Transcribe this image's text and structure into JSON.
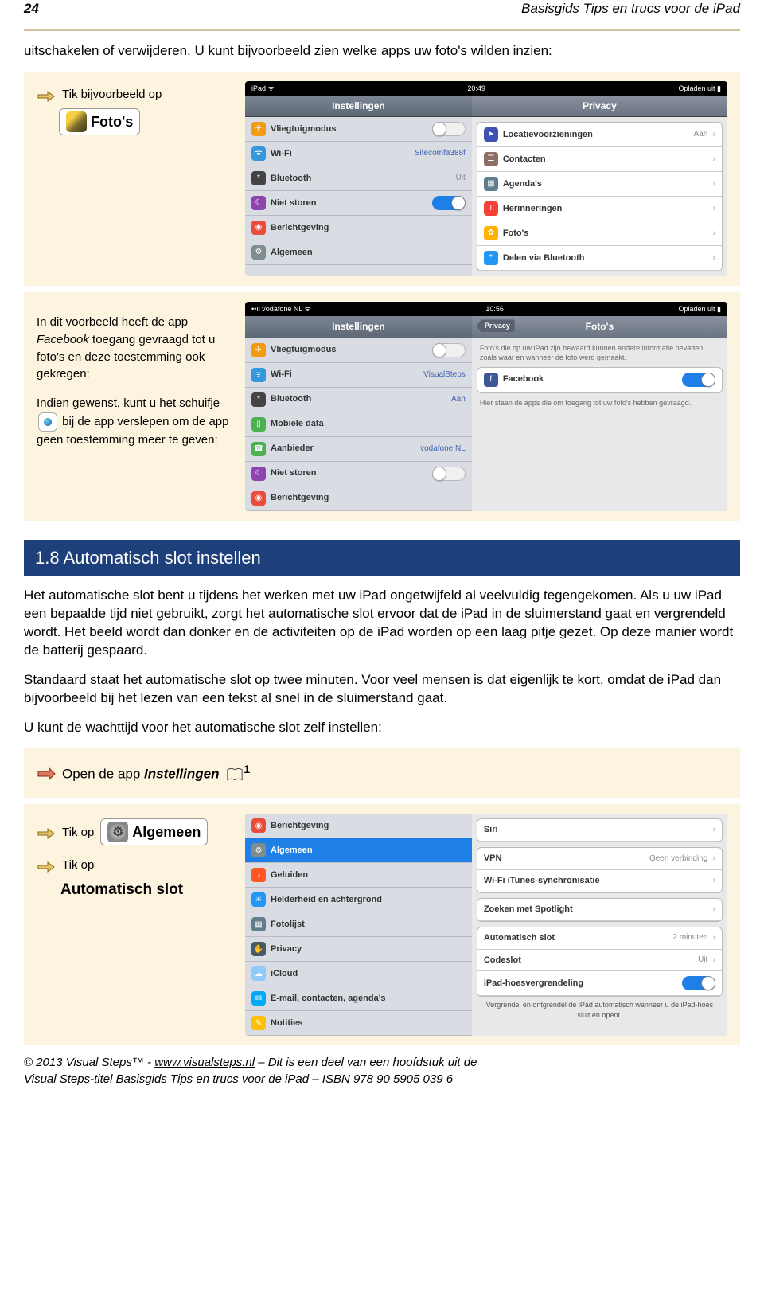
{
  "header": {
    "page": "24",
    "title": "Basisgids Tips en trucs voor de iPad"
  },
  "p1": "uitschakelen of verwijderen. U kunt bijvoorbeeld zien welke apps uw foto's wilden inzien:",
  "instr1": {
    "prefix": "Tik bijvoorbeeld op",
    "label": "Foto's"
  },
  "shot1": {
    "status": {
      "left": "iPad ᯤ",
      "mid": "20:49",
      "right": "Opladen uit ▮"
    },
    "leftTitle": "Instellingen",
    "rightTitle": "Privacy",
    "left": [
      {
        "icon": "#f39c12",
        "glyph": "✈",
        "lbl": "Vliegtuigmodus",
        "toggle": "off"
      },
      {
        "icon": "#3498db",
        "glyph": "ᯤ",
        "lbl": "Wi-Fi",
        "val": "Sitecomfa388f"
      },
      {
        "icon": "#444",
        "glyph": "*",
        "lbl": "Bluetooth",
        "valg": "Uit"
      },
      {
        "icon": "#8e44ad",
        "glyph": "☾",
        "lbl": "Niet storen",
        "toggle": "on"
      },
      {
        "icon": "#e74c3c",
        "glyph": "◉",
        "lbl": "Berichtgeving"
      },
      {
        "icon": "#7f8c8d",
        "glyph": "⚙",
        "lbl": "Algemeen"
      }
    ],
    "right": [
      {
        "icon": "#3f51b5",
        "glyph": "➤",
        "lbl": "Locatievoorzieningen",
        "valg": "Aan",
        "chev": true
      },
      {
        "icon": "#8d6e63",
        "glyph": "☰",
        "lbl": "Contacten",
        "chev": true
      },
      {
        "icon": "#607d8b",
        "glyph": "▦",
        "lbl": "Agenda's",
        "chev": true
      },
      {
        "icon": "#f44336",
        "glyph": "!",
        "lbl": "Herinneringen",
        "chev": true
      },
      {
        "icon": "#ffb300",
        "glyph": "✿",
        "lbl": "Foto's",
        "chev": true
      },
      {
        "icon": "#2196f3",
        "glyph": "*",
        "lbl": "Delen via Bluetooth",
        "chev": true
      }
    ]
  },
  "cream2": {
    "t1": "In dit voorbeeld heeft de app ",
    "t1b": "Facebook",
    "t1c": " toegang gevraagd tot u foto's en deze toestemming ook gekregen:",
    "t2a": "Indien gewenst, kunt u het schuifje ",
    "t2b": " bij de app verslepen om de app geen toestemming meer te geven:"
  },
  "shot2": {
    "status": {
      "left": "••ıl vodafone NL ᯤ",
      "mid": "10:56",
      "right": "Opladen uit ▮"
    },
    "leftTitle": "Instellingen",
    "rightTitle": "Foto's",
    "back": "Privacy",
    "note": "Foto's die op uw iPad zijn bewaard kunnen andere informatie bevatten, zoals waar en wanneer de foto werd gemaakt.",
    "fb": "Facebook",
    "note2": "Hier staan de apps die om toegang tot uw foto's hebben gevraagd.",
    "left": [
      {
        "icon": "#f39c12",
        "glyph": "✈",
        "lbl": "Vliegtuigmodus",
        "toggle": "off"
      },
      {
        "icon": "#3498db",
        "glyph": "ᯤ",
        "lbl": "Wi-Fi",
        "val": "VisualSteps"
      },
      {
        "icon": "#444",
        "glyph": "*",
        "lbl": "Bluetooth",
        "val": "Aan"
      },
      {
        "icon": "#4caf50",
        "glyph": "▯",
        "lbl": "Mobiele data"
      },
      {
        "icon": "#4caf50",
        "glyph": "☎",
        "lbl": "Aanbieder",
        "val": "vodafone NL"
      },
      {
        "icon": "#8e44ad",
        "glyph": "☾",
        "lbl": "Niet storen",
        "toggle": "off"
      },
      {
        "icon": "#e74c3c",
        "glyph": "◉",
        "lbl": "Berichtgeving"
      }
    ]
  },
  "sec": "1.8 Automatisch slot instellen",
  "p2": "Het automatische slot bent u tijdens het werken met uw iPad ongetwijfeld al veelvuldig tegengekomen. Als u uw iPad een bepaalde tijd niet gebruikt, zorgt het automatische slot ervoor dat de iPad in de sluimerstand gaat en vergrendeld wordt. Het beeld wordt dan donker en de activiteiten op de iPad worden op een laag pitje gezet. Op deze manier wordt de batterij gespaard.",
  "p3": "Standaard staat het automatische slot op twee minuten. Voor veel mensen is dat eigenlijk te kort, omdat de iPad dan bijvoorbeeld bij het lezen van een tekst al snel in de sluimerstand gaat.",
  "p4": "U kunt de wachttijd voor het automatische slot zelf instellen:",
  "instr2": {
    "prefix": "Open de app ",
    "label": "Instellingen",
    "sup": "1"
  },
  "instr3": {
    "prefix": "Tik op",
    "label": "Algemeen"
  },
  "instr4": {
    "prefix": "Tik op",
    "label": "Automatisch slot"
  },
  "shot3": {
    "left": [
      {
        "icon": "#e74c3c",
        "glyph": "◉",
        "lbl": "Berichtgeving"
      },
      {
        "icon": "#7f8c8d",
        "glyph": "⚙",
        "lbl": "Algemeen",
        "sel": true
      },
      {
        "icon": "#ff5722",
        "glyph": "♪",
        "lbl": "Geluiden"
      },
      {
        "icon": "#2196f3",
        "glyph": "☀",
        "lbl": "Helderheid en achtergrond"
      },
      {
        "icon": "#607d8b",
        "glyph": "▦",
        "lbl": "Fotolijst"
      },
      {
        "icon": "#455a64",
        "glyph": "✋",
        "lbl": "Privacy"
      },
      {
        "icon": "#90caf9",
        "glyph": "☁",
        "lbl": "iCloud"
      },
      {
        "icon": "#03a9f4",
        "glyph": "✉",
        "lbl": "E-mail, contacten, agenda's"
      },
      {
        "icon": "#ffc107",
        "glyph": "✎",
        "lbl": "Notities"
      }
    ],
    "right": [
      {
        "lbl": "Siri",
        "chev": true
      },
      {
        "lbl": "VPN",
        "valg": "Geen verbinding",
        "chev": true
      },
      {
        "lbl": "Wi-Fi iTunes-synchronisatie",
        "chev": true
      },
      {
        "lbl": "Zoeken met Spotlight",
        "chev": true
      },
      {
        "lbl": "Automatisch slot",
        "valg": "2 minuten",
        "chev": true
      },
      {
        "lbl": "Codeslot",
        "valg": "Uit",
        "chev": true
      },
      {
        "lbl": "iPad-hoesvergrendeling",
        "toggle": "on"
      }
    ],
    "foot": "Vergrendel en ontgrendel de iPad automatisch wanneer u de iPad-hoes sluit en opent."
  },
  "footer": {
    "l1a": "© 2013 Visual Steps™ - ",
    "l1b": "www.visualsteps.nl",
    "l1c": " – Dit is een deel van een hoofdstuk uit de",
    "l2": "Visual Steps-titel Basisgids Tips en trucs voor de iPad – ISBN 978 90 5905 039 6"
  }
}
